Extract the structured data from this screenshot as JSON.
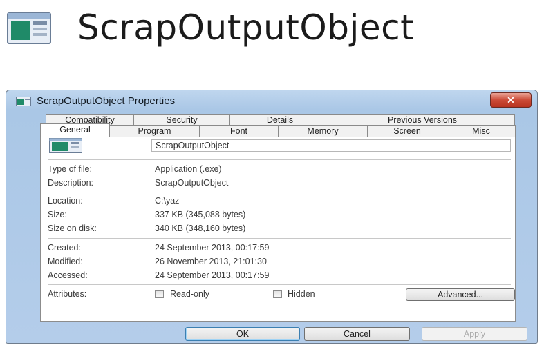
{
  "file_name": "ScrapOutputObject",
  "dialog": {
    "title": "ScrapOutputObject Properties",
    "close_label": "✕",
    "tabs_back": [
      "Compatibility",
      "Security",
      "Details",
      "Previous Versions"
    ],
    "tabs_front": [
      "General",
      "Program",
      "Font",
      "Memory",
      "Screen",
      "Misc"
    ],
    "active_tab": "General",
    "name_value": "ScrapOutputObject",
    "fields": {
      "type_label": "Type of file:",
      "type_value": "Application (.exe)",
      "description_label": "Description:",
      "description_value": "ScrapOutputObject",
      "location_label": "Location:",
      "location_value": "C:\\yaz",
      "size_label": "Size:",
      "size_value": "337 KB (345,088 bytes)",
      "size_on_disk_label": "Size on disk:",
      "size_on_disk_value": "340 KB (348,160 bytes)",
      "created_label": "Created:",
      "created_value": "24 September 2013, 00:17:59",
      "modified_label": "Modified:",
      "modified_value": "26 November 2013, 21:01:30",
      "accessed_label": "Accessed:",
      "accessed_value": "24 September 2013, 00:17:59",
      "attributes_label": "Attributes:"
    },
    "attributes": {
      "readonly_label": "Read-only",
      "readonly_checked": false,
      "hidden_label": "Hidden",
      "hidden_checked": false,
      "advanced_label": "Advanced..."
    },
    "buttons": {
      "ok": "OK",
      "cancel": "Cancel",
      "apply": "Apply"
    },
    "colors": {
      "titlebar": "#aac7e6",
      "close": "#cc4b37",
      "default_border": "#3c7fb1"
    }
  }
}
